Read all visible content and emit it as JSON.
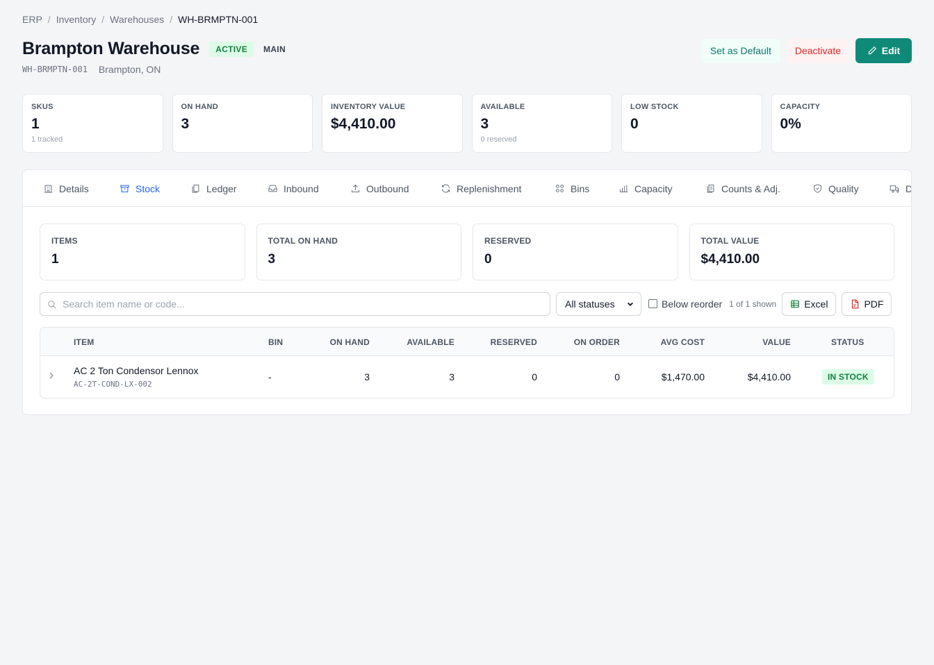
{
  "breadcrumb": {
    "items": [
      "ERP",
      "Inventory",
      "Warehouses"
    ],
    "current": "WH-BRMPTN-001",
    "separator": "/"
  },
  "header": {
    "title": "Brampton Warehouse",
    "status_badge": "ACTIVE",
    "type_badge": "MAIN",
    "code": "WH-BRMPTN-001",
    "location": "Brampton, ON",
    "actions": {
      "set_default": "Set as Default",
      "deactivate": "Deactivate",
      "edit": "Edit"
    }
  },
  "stats": [
    {
      "label": "SKUS",
      "value": "1",
      "sub": "1 tracked"
    },
    {
      "label": "ON HAND",
      "value": "3",
      "sub": ""
    },
    {
      "label": "INVENTORY VALUE",
      "value": "$4,410.00",
      "sub": ""
    },
    {
      "label": "AVAILABLE",
      "value": "3",
      "sub": "0 reserved"
    },
    {
      "label": "LOW STOCK",
      "value": "0",
      "sub": ""
    },
    {
      "label": "CAPACITY",
      "value": "0%",
      "sub": ""
    }
  ],
  "tabs": [
    {
      "label": "Details",
      "icon": "building-icon"
    },
    {
      "label": "Stock",
      "icon": "box-icon",
      "active": true
    },
    {
      "label": "Ledger",
      "icon": "copy-icon"
    },
    {
      "label": "Inbound",
      "icon": "inbox-icon"
    },
    {
      "label": "Outbound",
      "icon": "upload-icon"
    },
    {
      "label": "Replenishment",
      "icon": "refresh-icon"
    },
    {
      "label": "Bins",
      "icon": "grid-icon"
    },
    {
      "label": "Capacity",
      "icon": "bar-chart-icon"
    },
    {
      "label": "Counts & Adj.",
      "icon": "clipboard-icon"
    },
    {
      "label": "Quality",
      "icon": "shield-icon"
    },
    {
      "label": "D",
      "icon": "truck-icon"
    }
  ],
  "stock": {
    "summary": [
      {
        "label": "ITEMS",
        "value": "1"
      },
      {
        "label": "TOTAL ON HAND",
        "value": "3"
      },
      {
        "label": "RESERVED",
        "value": "0"
      },
      {
        "label": "TOTAL VALUE",
        "value": "$4,410.00"
      }
    ],
    "search_placeholder": "Search item name or code...",
    "status_filter": "All statuses",
    "below_reorder_label": "Below reorder",
    "shown_text": "1 of 1 shown",
    "export_excel": "Excel",
    "export_pdf": "PDF",
    "columns": {
      "item": "ITEM",
      "bin": "BIN",
      "on_hand": "ON HAND",
      "available": "AVAILABLE",
      "reserved": "RESERVED",
      "on_order": "ON ORDER",
      "avg_cost": "AVG COST",
      "value": "VALUE",
      "status": "STATUS"
    },
    "rows": [
      {
        "name": "AC 2 Ton Condensor Lennox",
        "code": "AC-2T-COND-LX-002",
        "bin": "-",
        "on_hand": "3",
        "available": "3",
        "reserved": "0",
        "on_order": "0",
        "avg_cost": "$1,470.00",
        "value": "$4,410.00",
        "status": "IN STOCK"
      }
    ]
  },
  "colors": {
    "accent": "#2563eb",
    "primary_button": "#0f8a78",
    "success_bg": "#dcfce7",
    "success_text": "#15803d",
    "danger": "#dc2626"
  }
}
